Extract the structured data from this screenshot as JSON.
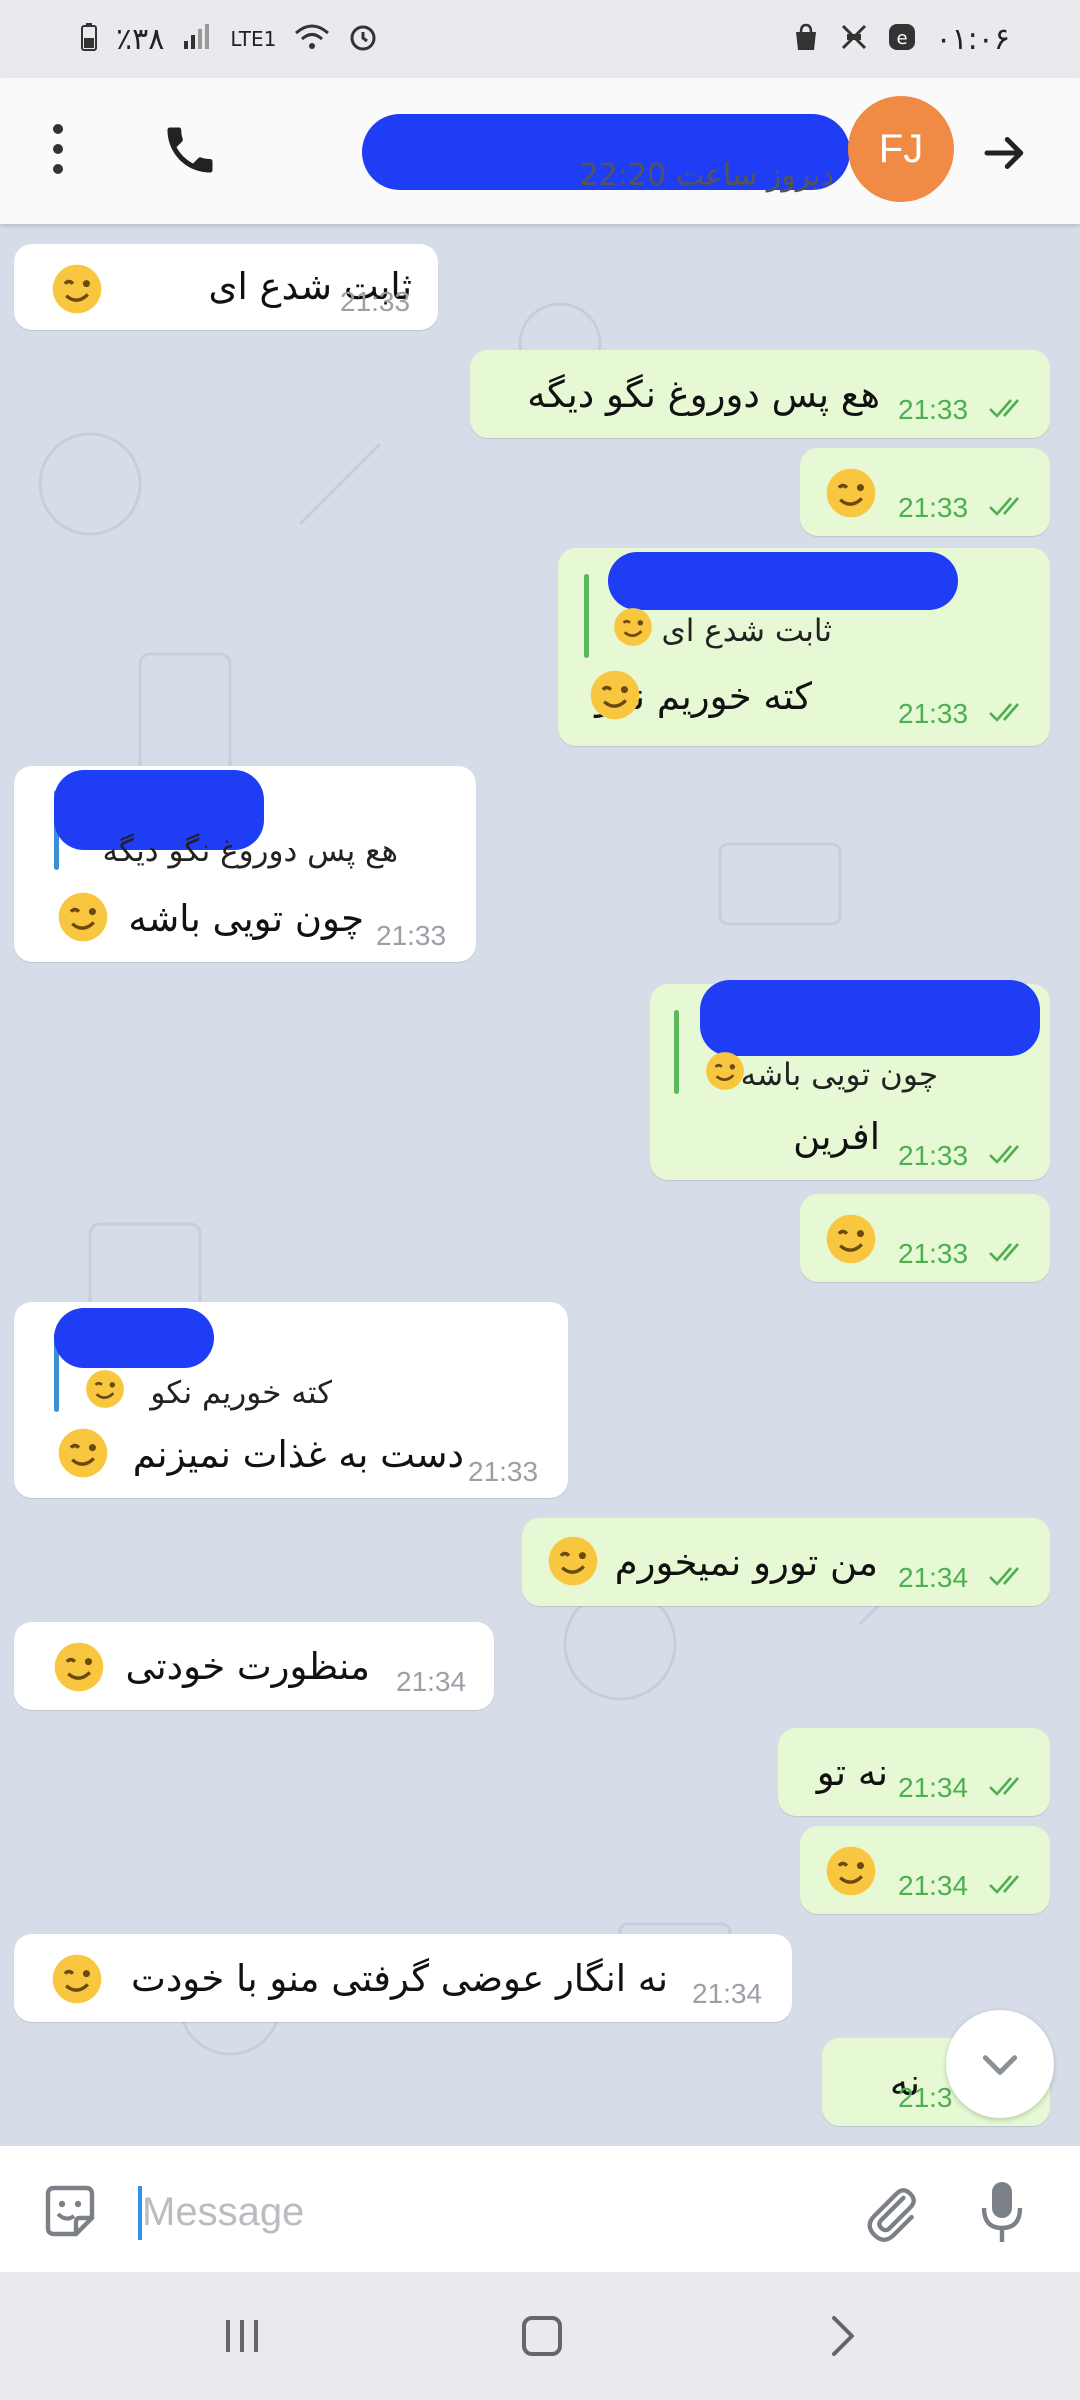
{
  "status_bar": {
    "battery": "٪۳۸",
    "network": "LTE1",
    "clock": "۰۱:۰۶"
  },
  "header": {
    "last_seen": "دیروز ساعت 22:20",
    "avatar_initials": "FJ",
    "icons": [
      "more-vertical-icon",
      "phone-icon",
      "arrow-forward-icon"
    ]
  },
  "messages": [
    {
      "dir": "in",
      "text": "ثابت شدع ای",
      "emoji": "wink",
      "time": "21:33"
    },
    {
      "dir": "out",
      "text": "هع پس دوروغ نگو دیگه",
      "time": "21:33"
    },
    {
      "dir": "out",
      "text": "",
      "emoji": "wink",
      "time": "21:33"
    },
    {
      "dir": "out",
      "quote": "ثابت شدع ای",
      "quote_emoji": "wink",
      "text": "کته خوریم نکو",
      "emoji": "wink",
      "time": "21:33"
    },
    {
      "dir": "in",
      "quote": "هع پس دوروغ نگو دیگه",
      "text": "چون تویی باشه",
      "emoji": "wink",
      "time": "21:33"
    },
    {
      "dir": "out",
      "quote": "چون تویی باشه",
      "quote_emoji": "wink",
      "text": "افرین",
      "time": "21:33"
    },
    {
      "dir": "out",
      "text": "",
      "emoji": "wink",
      "time": "21:33"
    },
    {
      "dir": "in",
      "quote": "کته خوریم نکو",
      "quote_emoji": "wink",
      "text": "دست به غذات نمیزنم",
      "emoji": "wink",
      "time": "21:33"
    },
    {
      "dir": "out",
      "text": "من تورو نمیخورم",
      "emoji": "wink",
      "time": "21:34"
    },
    {
      "dir": "in",
      "text": "منظورت خودتی",
      "emoji": "wink",
      "time": "21:34"
    },
    {
      "dir": "out",
      "text": "نه تو",
      "time": "21:34"
    },
    {
      "dir": "out",
      "text": "",
      "emoji": "wink",
      "time": "21:34"
    },
    {
      "dir": "in",
      "text": "نه انگار عوضی گرفتی منو با خودت",
      "emoji": "wink",
      "time": "21:34"
    },
    {
      "dir": "out",
      "text": "نه",
      "time": "21:3"
    }
  ],
  "composer": {
    "placeholder": "Message",
    "icons": [
      "sticker-icon",
      "attach-icon",
      "mic-icon"
    ]
  },
  "colors": {
    "accent": "#3390ec",
    "outgoing_bubble": "#e6f9d4",
    "incoming_bubble": "#ffffff",
    "avatar": "#f08b46",
    "chat_background": "#d7dde8"
  }
}
